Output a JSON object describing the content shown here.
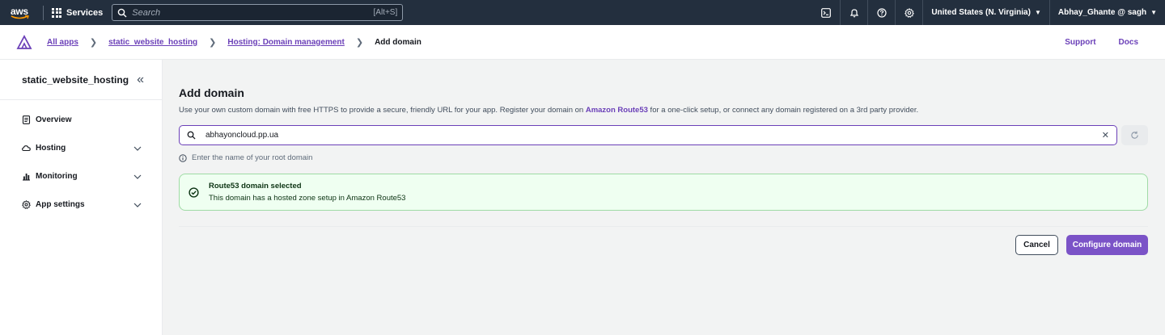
{
  "topnav": {
    "logo_text": "aws",
    "services_label": "Services",
    "search_placeholder": "Search",
    "search_shortcut": "[Alt+S]",
    "region": "United States (N. Virginia)",
    "account": "Abhay_Ghante @ sagh"
  },
  "breadcrumb": {
    "items": [
      "All apps",
      "static_website_hosting",
      "Hosting: Domain management"
    ],
    "current": "Add domain",
    "support": "Support",
    "docs": "Docs"
  },
  "sidebar": {
    "title": "static_website_hosting",
    "items": [
      {
        "label": "Overview",
        "icon": "document-icon"
      },
      {
        "label": "Hosting",
        "icon": "cloud-icon"
      },
      {
        "label": "Monitoring",
        "icon": "chart-icon"
      },
      {
        "label": "App settings",
        "icon": "gear-icon"
      }
    ]
  },
  "main": {
    "title": "Add domain",
    "description_pre": "Use your own custom domain with free HTTPS to provide a secure, friendly URL for your app. Register your domain on ",
    "description_link": "Amazon Route53",
    "description_post": " for a one-click setup, or connect any domain registered on a 3rd party provider.",
    "domain_value": "abhayoncloud.pp.ua",
    "hint": "Enter the name of your root domain",
    "alert_title": "Route53 domain selected",
    "alert_text": "This domain has a hosted zone setup in Amazon Route53",
    "cancel_label": "Cancel",
    "primary_label": "Configure domain"
  },
  "colors": {
    "nav_bg": "#232f3e",
    "accent": "#7b53c7",
    "link": "#6b40b8",
    "success_bg": "#effff1"
  }
}
